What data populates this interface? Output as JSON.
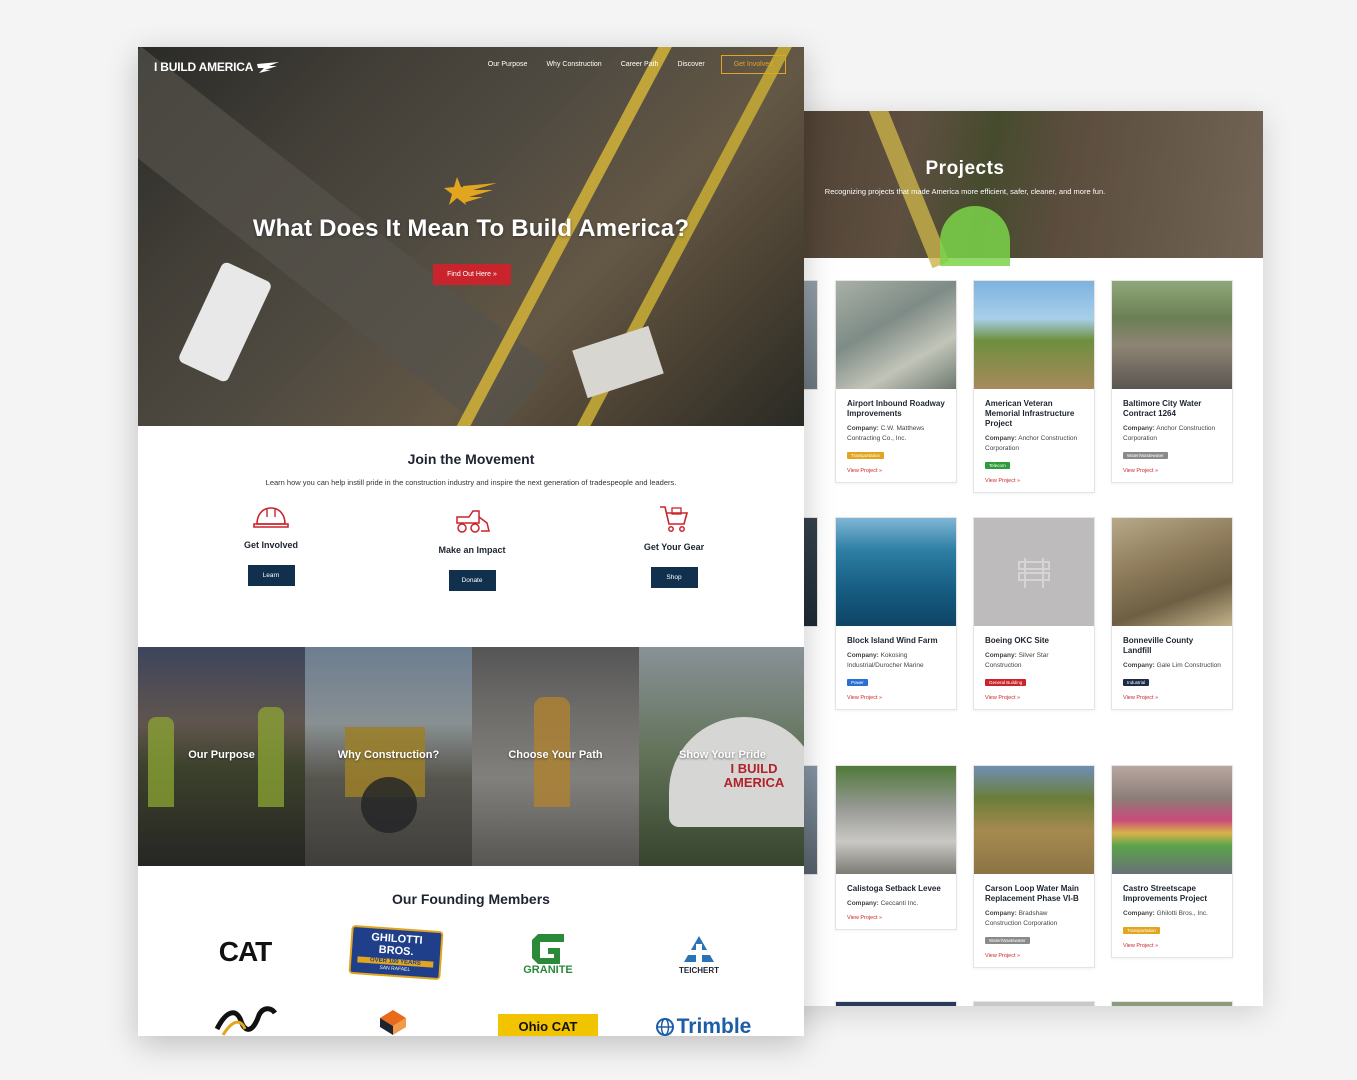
{
  "projects_page": {
    "hero": {
      "title": "Projects",
      "subtitle": "Recognizing projects that made America more efficient, safer, cleaner, and more fun."
    },
    "company_label": "Company:",
    "cards": [
      {
        "name": "Airport Inbound Roadway Improvements",
        "company": "C.W. Matthews Contracting Co., Inc.",
        "tag": "Transportation",
        "tag_color": "#e2a51f",
        "link": "View Project »"
      },
      {
        "name": "American Veteran Memorial Infrastructure Project",
        "company": "Anchor Construction Corporation",
        "tag": "Telecom",
        "tag_color": "#2e9c3a",
        "link": "View Project »"
      },
      {
        "name": "Baltimore City Water Contract 1264",
        "company": "Anchor Construction Corporation",
        "tag": "Water/Wastewater",
        "tag_color": "#8a8a8a",
        "link": "View Project »"
      },
      {
        "name": "Block Island Wind Farm",
        "company": "Kokosing Industrial/Durocher Marine",
        "tag": "Power",
        "tag_color": "#2a6fd6",
        "link": "View Project »"
      },
      {
        "name": "Boeing OKC Site",
        "company": "Silver Star Construction",
        "tag": "General Building",
        "tag_color": "#c9242b",
        "link": "View Project »"
      },
      {
        "name": "Bonneville County Landfill",
        "company": "Gale Lim Construction",
        "tag": "Industrial",
        "tag_color": "#1d2b45",
        "link": "View Project »"
      },
      {
        "name": "Calistoga Setback Levee",
        "company": "Ceccanti Inc.",
        "tag": "",
        "tag_color": "",
        "link": "View Project »"
      },
      {
        "name": "Carson Loop Water Main Replacement Phase VI-B",
        "company": "Bradshaw Construction Corporation",
        "tag": "Water/Wastewater",
        "tag_color": "#8a8a8a",
        "link": "View Project »"
      },
      {
        "name": "Castro Streetscape Improvements Project",
        "company": "Ghilotti Bros., Inc.",
        "tag": "Transportation",
        "tag_color": "#e2a51f",
        "link": "View Project »"
      }
    ]
  },
  "home_page": {
    "logo": {
      "text": "I BUILD AMERICA",
      "icon": "star-wing-icon"
    },
    "nav": {
      "items": [
        "Our Purpose",
        "Why Construction",
        "Career Path",
        "Discover"
      ],
      "cta": "Get Involved"
    },
    "hero": {
      "title": "What Does It Mean To Build America?",
      "button": "Find Out Here »"
    },
    "join": {
      "title": "Join the Movement",
      "subtitle": "Learn how you can help instill pride in the construction industry and inspire the next generation of tradespeople and leaders.",
      "features": [
        {
          "label": "Get Involved",
          "button": "Learn",
          "icon": "hard-hat-icon"
        },
        {
          "label": "Make an Impact",
          "button": "Donate",
          "icon": "skid-steer-icon"
        },
        {
          "label": "Get Your Gear",
          "button": "Shop",
          "icon": "shopping-cart-icon"
        }
      ]
    },
    "tiles": [
      "Our Purpose",
      "Why Construction?",
      "Choose Your Path",
      "Show Your Pride"
    ],
    "founders": {
      "title": "Our Founding Members",
      "logos": [
        "CAT",
        "GHILOTTI BROS.",
        "GRANITE",
        "TEICHERT",
        "Ohio CAT",
        "Trimble"
      ],
      "ghilotti_sub": "OVER 100 YEARS",
      "ghilotti_loc": "SAN RAFAEL",
      "hat_text": "I BUILD AMERICA"
    },
    "colors": {
      "accent_red": "#c9242b",
      "gold": "#e2a51f",
      "navy": "#11304d"
    }
  }
}
